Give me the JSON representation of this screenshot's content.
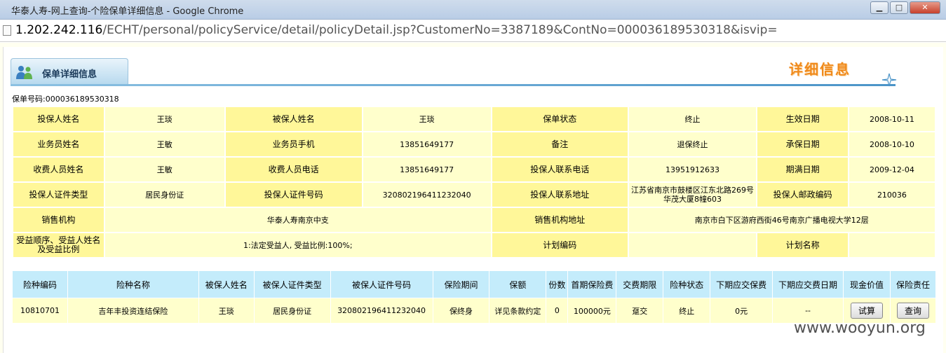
{
  "window": {
    "title": "华泰人寿-网上查询-个险保单详细信息 - Google Chrome",
    "minimize": "▁",
    "maximize": "□",
    "close": "✕"
  },
  "address": {
    "host": "1.202.242.116",
    "path": "/ECHT/personal/policyService/detail/policyDetail.jsp?CustomerNo=3387189&ContNo=000036189530318&isvip="
  },
  "header": {
    "tab_label": "保单详细信息",
    "brand_text": "详细信息"
  },
  "policy_no": "保单号码:000036189530318",
  "detail": {
    "row1": [
      "投保人姓名",
      "王琰",
      "被保人姓名",
      "王琰",
      "保单状态",
      "终止",
      "生效日期",
      "2008-10-11"
    ],
    "row2": [
      "业务员姓名",
      "王敏",
      "业务员手机",
      "13851649177",
      "备注",
      "退保终止",
      "承保日期",
      "2008-10-10"
    ],
    "row3": [
      "收费人员姓名",
      "王敏",
      "收费人员电话",
      "13851649177",
      "投保人联系电话",
      "13951912633",
      "期满日期",
      "2009-12-04"
    ],
    "row4": [
      "投保人证件类型",
      "居民身份证",
      "投保人证件号码",
      "320802196411232040",
      "投保人联系地址",
      "江苏省南京市鼓楼区江东北路269号华茂大厦8幢603",
      "投保人邮政编码",
      "210036"
    ],
    "row5": [
      "销售机构",
      "华泰人寿南京中支",
      "销售机构地址",
      "南京市白下区游府西街46号南京广播电视大学12层"
    ],
    "row6": [
      "受益顺序、受益人姓名及受益比例",
      "1:法定受益人, 受益比例:100%;",
      "计划编码",
      "",
      "计划名称",
      ""
    ]
  },
  "products": {
    "headers": [
      "险种编码",
      "险种名称",
      "被保人姓名",
      "被保人证件类型",
      "被保人证件号码",
      "保险期间",
      "保额",
      "份数",
      "首期保险费",
      "交费期限",
      "险种状态",
      "下期应交保费",
      "下期应交费日期",
      "现金价值",
      "保险责任"
    ],
    "rows": [
      [
        "10810701",
        "吉年丰投资连结保险",
        "王琰",
        "居民身份证",
        "320802196411232040",
        "保终身",
        "详见条款约定",
        "0",
        "100000元",
        "趸交",
        "终止",
        "0元",
        "--",
        "试算",
        "查询"
      ]
    ]
  },
  "watermark": "www.wooyun.org"
}
